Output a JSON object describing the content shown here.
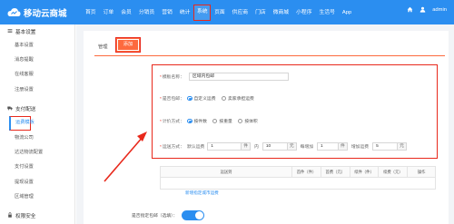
{
  "header": {
    "brand": "移动云商城",
    "nav": [
      {
        "label": "首页",
        "active": false
      },
      {
        "label": "订单",
        "active": false
      },
      {
        "label": "会员",
        "active": false
      },
      {
        "label": "分销员",
        "active": false
      },
      {
        "label": "营销",
        "active": false
      },
      {
        "label": "统计",
        "active": false
      },
      {
        "label": "系统",
        "active": true
      },
      {
        "label": "页面",
        "active": false
      },
      {
        "label": "供应商",
        "active": false
      },
      {
        "label": "门店",
        "active": false
      },
      {
        "label": "微商城",
        "active": false
      },
      {
        "label": "小程序",
        "active": false
      },
      {
        "label": "生活号",
        "active": false
      },
      {
        "label": "App",
        "active": false
      }
    ],
    "user": "admin",
    "home_icon": "home-icon",
    "user_icon": "user-icon",
    "colors": {
      "bar": "#2b8ef0",
      "highlight": "#e8281b"
    }
  },
  "sidebar": {
    "groups": [
      {
        "title": "基本设置",
        "icon": "menu-icon",
        "items": [
          "基本设置",
          "消息提醒",
          "在线客服",
          "注册设置"
        ]
      },
      {
        "title": "支付配送",
        "icon": "truck-icon",
        "items": [
          "运费模板",
          "物流公司",
          "达达物流配置",
          "支付设置",
          "提现设置",
          "区域管理"
        ]
      },
      {
        "title": "权限安全",
        "icon": "lock-icon",
        "items": []
      }
    ],
    "active_item": "运费模板"
  },
  "tabs": [
    {
      "label": "管理",
      "active": false
    },
    {
      "label": "添加",
      "active": true
    }
  ],
  "form": {
    "name_label": "模板名称：",
    "name_value": "区域内包邮",
    "free_label": "是否包邮：",
    "free_options": [
      {
        "label": "自定义运费",
        "checked": true
      },
      {
        "label": "卖家承担运费",
        "checked": false
      }
    ],
    "method_label": "计价方式：",
    "method_options": [
      {
        "label": "按件数",
        "checked": true
      },
      {
        "label": "按重量",
        "checked": false
      },
      {
        "label": "按体积",
        "checked": false
      }
    ],
    "ship_label": "运送方式：",
    "default_freight": "默认运费",
    "first_qty": "1",
    "unit_piece": "件",
    "inner": "内",
    "first_fee": "10",
    "unit_yuan": "元",
    "each_add": "每增加",
    "add_qty": "1",
    "add_fee_label": "增加运费",
    "add_fee": "5",
    "unit_yuan2": "元"
  },
  "table": {
    "headers": [
      "运送到",
      "首件（件）",
      "首费（元）",
      "续件（件）",
      "续费（元）",
      "操作"
    ]
  },
  "add_link": "新增指定城市运费",
  "free_condition": {
    "label": "是否指定包邮（选填）：",
    "enabled": true
  }
}
